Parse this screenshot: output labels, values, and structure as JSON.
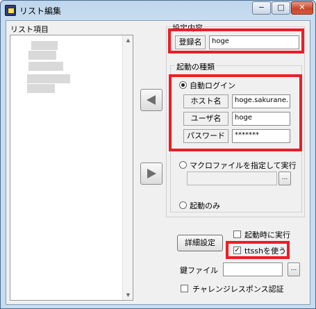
{
  "window": {
    "title": "リスト編集",
    "min_icon": "minimize-icon",
    "max_icon": "maximize-icon",
    "close_icon": "close-icon",
    "min_glyph": "−",
    "max_glyph": "□",
    "close_glyph": "✕"
  },
  "list": {
    "title": "リスト項目",
    "scroll_up_glyph": "▲",
    "scroll_down_glyph": "▼"
  },
  "move_buttons": {
    "left_icon": "arrow-left-icon",
    "right_icon": "arrow-right-icon"
  },
  "settings": {
    "legend": "設定内容",
    "register_name_label": "登録名",
    "register_name_value": "hoge"
  },
  "startup": {
    "legend": "起動の種類",
    "auto_login_label": "自動ログイン",
    "host_label": "ホスト名",
    "host_value": "hoge.sakurane.",
    "user_label": "ユーザ名",
    "user_value": "hoge",
    "password_label": "パスワード",
    "password_value": "*******",
    "macro_label": "マクロファイルを指定して実行",
    "macro_browse": "...",
    "startup_only_label": "起動のみ"
  },
  "options": {
    "detail_button": "詳細設定",
    "launch_on_start_label": "起動時に実行",
    "use_ttssh_label": "ttsshを使う",
    "use_ttssh_checked": true,
    "check_glyph": "✓",
    "key_file_label": "鍵ファイル",
    "key_file_value": "",
    "key_browse": "...",
    "challenge_label": "チャレンジレスポンス認証"
  },
  "colors": {
    "highlight": "#ee1c25"
  }
}
